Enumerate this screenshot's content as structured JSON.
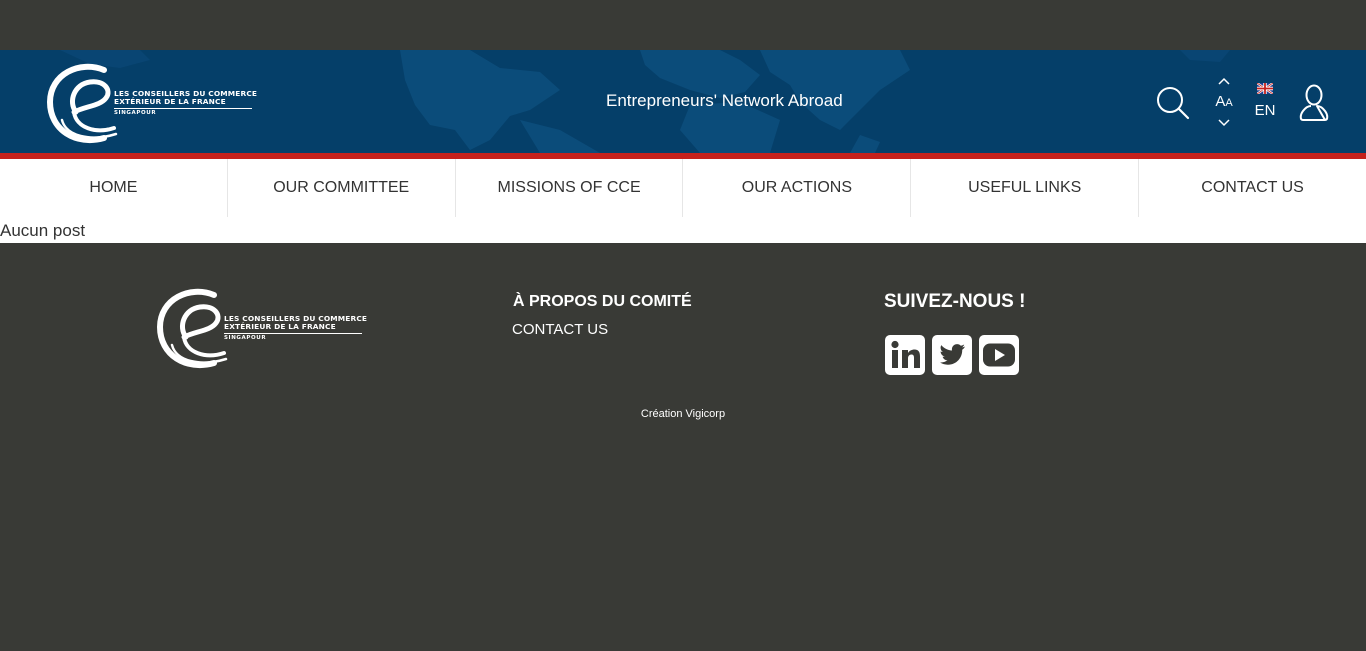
{
  "header": {
    "logo": {
      "line1": "LES CONSEILLERS DU COMMERCE",
      "line2": "EXTÉRIEUR DE LA FRANCE",
      "line3": "SINGAPOUR"
    },
    "tagline": "Entrepreneurs' Network Abroad",
    "font_size_label": "A",
    "font_size_label_small": "A",
    "language_label": "EN",
    "icons": [
      "search-icon",
      "font-size-increase-icon",
      "font-size-decrease-icon",
      "uk-flag-icon",
      "user-icon"
    ]
  },
  "nav": {
    "items": [
      {
        "label": "HOME"
      },
      {
        "label": "OUR COMMITTEE"
      },
      {
        "label": "MISSIONS OF CCE"
      },
      {
        "label": "OUR ACTIONS"
      },
      {
        "label": "USEFUL LINKS"
      },
      {
        "label": "CONTACT US"
      }
    ]
  },
  "content": {
    "empty_message": "Aucun post"
  },
  "footer": {
    "logo": {
      "line1": "LES CONSEILLERS DU COMMERCE",
      "line2": "EXTÉRIEUR DE LA FRANCE",
      "line3": "SINGAPOUR"
    },
    "about_title": "À PROPOS DU COMITÉ",
    "about_link": "CONTACT US",
    "follow_title": "SUIVEZ-NOUS !",
    "social_icons": [
      "linkedin-icon",
      "twitter-icon",
      "youtube-icon"
    ],
    "credit": "Création Vigicorp"
  },
  "colors": {
    "page_background": "#393a36",
    "header_blue": "#053f69",
    "accent_red": "#c6211c",
    "nav_background": "#ffffff",
    "nav_text": "#333333"
  }
}
